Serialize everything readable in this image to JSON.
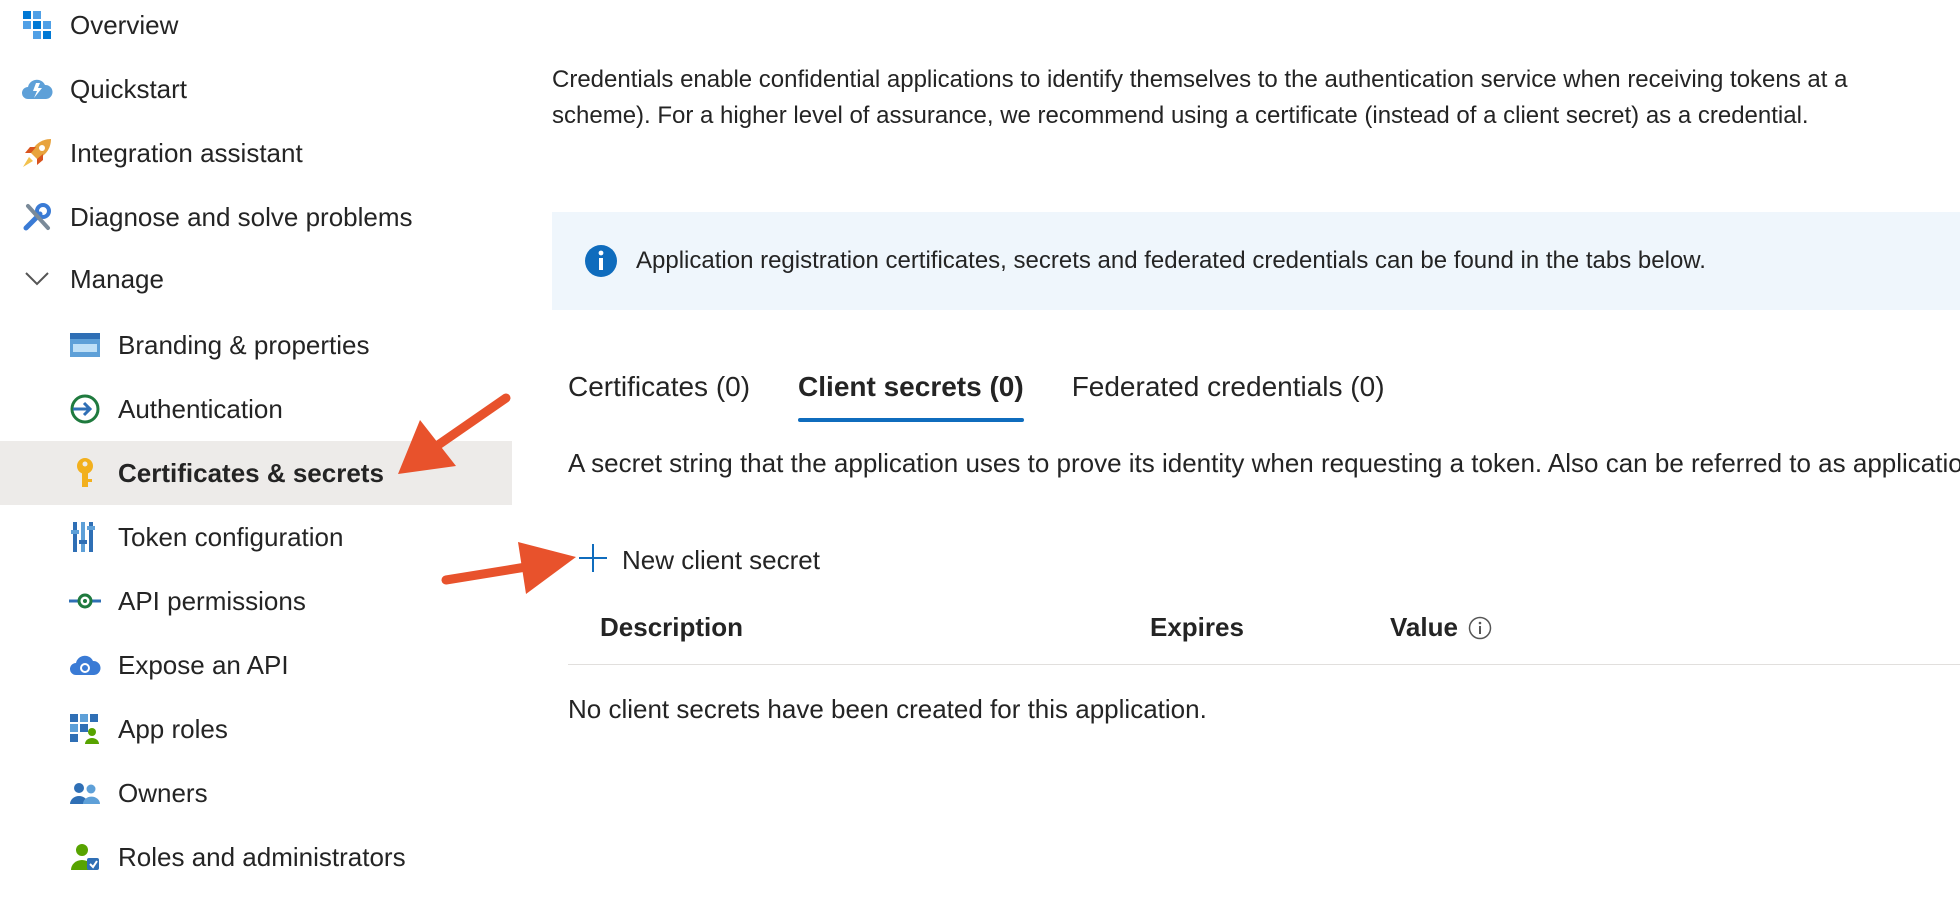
{
  "sidebar": {
    "items": [
      {
        "label": "Overview",
        "icon": "overview-grid-icon"
      },
      {
        "label": "Quickstart",
        "icon": "quickstart-cloud-icon"
      },
      {
        "label": "Integration assistant",
        "icon": "rocket-icon"
      },
      {
        "label": "Diagnose and solve problems",
        "icon": "wrench-icon"
      },
      {
        "label": "Manage",
        "icon": "chevron-down-icon"
      },
      {
        "label": "Branding & properties",
        "icon": "branding-icon"
      },
      {
        "label": "Authentication",
        "icon": "authentication-icon"
      },
      {
        "label": "Certificates & secrets",
        "icon": "key-icon",
        "active": true
      },
      {
        "label": "Token configuration",
        "icon": "token-config-icon"
      },
      {
        "label": "API permissions",
        "icon": "api-permissions-icon"
      },
      {
        "label": "Expose an API",
        "icon": "expose-api-cloud-icon"
      },
      {
        "label": "App roles",
        "icon": "app-roles-icon"
      },
      {
        "label": "Owners",
        "icon": "owners-icon"
      },
      {
        "label": "Roles and administrators",
        "icon": "roles-admins-icon"
      }
    ]
  },
  "main": {
    "intro_line1": "Credentials enable confidential applications to identify themselves to the authentication service when receiving tokens at a",
    "intro_line2": "scheme). For a higher level of assurance, we recommend using a certificate (instead of a client secret) as a credential.",
    "info_banner": "Application registration certificates, secrets and federated credentials can be found in the tabs below.",
    "tabs": [
      {
        "label": "Certificates (0)"
      },
      {
        "label": "Client secrets (0)",
        "active": true
      },
      {
        "label": "Federated credentials (0)"
      }
    ],
    "tab_description": "A secret string that the application uses to prove its identity when requesting a token. Also can be referred to as applicatio",
    "new_secret_label": "New client secret",
    "table": {
      "columns": [
        "Description",
        "Expires",
        "Value"
      ],
      "empty_message": "No client secrets have been created for this application."
    }
  },
  "colors": {
    "accent": "#0f6cbd",
    "active_nav_bg": "#edebe9",
    "info_banner_bg": "#eff6fc",
    "annotation_arrow": "#e8522c"
  }
}
